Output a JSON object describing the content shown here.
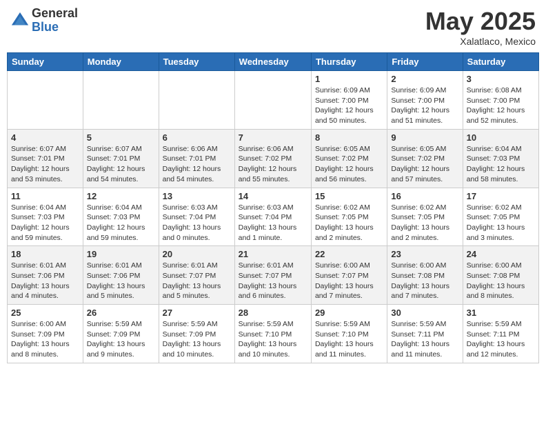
{
  "header": {
    "logo_general": "General",
    "logo_blue": "Blue",
    "month_title": "May 2025",
    "location": "Xalatlaco, Mexico"
  },
  "weekdays": [
    "Sunday",
    "Monday",
    "Tuesday",
    "Wednesday",
    "Thursday",
    "Friday",
    "Saturday"
  ],
  "weeks": [
    [
      {
        "day": "",
        "info": ""
      },
      {
        "day": "",
        "info": ""
      },
      {
        "day": "",
        "info": ""
      },
      {
        "day": "",
        "info": ""
      },
      {
        "day": "1",
        "info": "Sunrise: 6:09 AM\nSunset: 7:00 PM\nDaylight: 12 hours\nand 50 minutes."
      },
      {
        "day": "2",
        "info": "Sunrise: 6:09 AM\nSunset: 7:00 PM\nDaylight: 12 hours\nand 51 minutes."
      },
      {
        "day": "3",
        "info": "Sunrise: 6:08 AM\nSunset: 7:00 PM\nDaylight: 12 hours\nand 52 minutes."
      }
    ],
    [
      {
        "day": "4",
        "info": "Sunrise: 6:07 AM\nSunset: 7:01 PM\nDaylight: 12 hours\nand 53 minutes."
      },
      {
        "day": "5",
        "info": "Sunrise: 6:07 AM\nSunset: 7:01 PM\nDaylight: 12 hours\nand 54 minutes."
      },
      {
        "day": "6",
        "info": "Sunrise: 6:06 AM\nSunset: 7:01 PM\nDaylight: 12 hours\nand 54 minutes."
      },
      {
        "day": "7",
        "info": "Sunrise: 6:06 AM\nSunset: 7:02 PM\nDaylight: 12 hours\nand 55 minutes."
      },
      {
        "day": "8",
        "info": "Sunrise: 6:05 AM\nSunset: 7:02 PM\nDaylight: 12 hours\nand 56 minutes."
      },
      {
        "day": "9",
        "info": "Sunrise: 6:05 AM\nSunset: 7:02 PM\nDaylight: 12 hours\nand 57 minutes."
      },
      {
        "day": "10",
        "info": "Sunrise: 6:04 AM\nSunset: 7:03 PM\nDaylight: 12 hours\nand 58 minutes."
      }
    ],
    [
      {
        "day": "11",
        "info": "Sunrise: 6:04 AM\nSunset: 7:03 PM\nDaylight: 12 hours\nand 59 minutes."
      },
      {
        "day": "12",
        "info": "Sunrise: 6:04 AM\nSunset: 7:03 PM\nDaylight: 12 hours\nand 59 minutes."
      },
      {
        "day": "13",
        "info": "Sunrise: 6:03 AM\nSunset: 7:04 PM\nDaylight: 13 hours\nand 0 minutes."
      },
      {
        "day": "14",
        "info": "Sunrise: 6:03 AM\nSunset: 7:04 PM\nDaylight: 13 hours\nand 1 minute."
      },
      {
        "day": "15",
        "info": "Sunrise: 6:02 AM\nSunset: 7:05 PM\nDaylight: 13 hours\nand 2 minutes."
      },
      {
        "day": "16",
        "info": "Sunrise: 6:02 AM\nSunset: 7:05 PM\nDaylight: 13 hours\nand 2 minutes."
      },
      {
        "day": "17",
        "info": "Sunrise: 6:02 AM\nSunset: 7:05 PM\nDaylight: 13 hours\nand 3 minutes."
      }
    ],
    [
      {
        "day": "18",
        "info": "Sunrise: 6:01 AM\nSunset: 7:06 PM\nDaylight: 13 hours\nand 4 minutes."
      },
      {
        "day": "19",
        "info": "Sunrise: 6:01 AM\nSunset: 7:06 PM\nDaylight: 13 hours\nand 5 minutes."
      },
      {
        "day": "20",
        "info": "Sunrise: 6:01 AM\nSunset: 7:07 PM\nDaylight: 13 hours\nand 5 minutes."
      },
      {
        "day": "21",
        "info": "Sunrise: 6:01 AM\nSunset: 7:07 PM\nDaylight: 13 hours\nand 6 minutes."
      },
      {
        "day": "22",
        "info": "Sunrise: 6:00 AM\nSunset: 7:07 PM\nDaylight: 13 hours\nand 7 minutes."
      },
      {
        "day": "23",
        "info": "Sunrise: 6:00 AM\nSunset: 7:08 PM\nDaylight: 13 hours\nand 7 minutes."
      },
      {
        "day": "24",
        "info": "Sunrise: 6:00 AM\nSunset: 7:08 PM\nDaylight: 13 hours\nand 8 minutes."
      }
    ],
    [
      {
        "day": "25",
        "info": "Sunrise: 6:00 AM\nSunset: 7:09 PM\nDaylight: 13 hours\nand 8 minutes."
      },
      {
        "day": "26",
        "info": "Sunrise: 5:59 AM\nSunset: 7:09 PM\nDaylight: 13 hours\nand 9 minutes."
      },
      {
        "day": "27",
        "info": "Sunrise: 5:59 AM\nSunset: 7:09 PM\nDaylight: 13 hours\nand 10 minutes."
      },
      {
        "day": "28",
        "info": "Sunrise: 5:59 AM\nSunset: 7:10 PM\nDaylight: 13 hours\nand 10 minutes."
      },
      {
        "day": "29",
        "info": "Sunrise: 5:59 AM\nSunset: 7:10 PM\nDaylight: 13 hours\nand 11 minutes."
      },
      {
        "day": "30",
        "info": "Sunrise: 5:59 AM\nSunset: 7:11 PM\nDaylight: 13 hours\nand 11 minutes."
      },
      {
        "day": "31",
        "info": "Sunrise: 5:59 AM\nSunset: 7:11 PM\nDaylight: 13 hours\nand 12 minutes."
      }
    ]
  ]
}
